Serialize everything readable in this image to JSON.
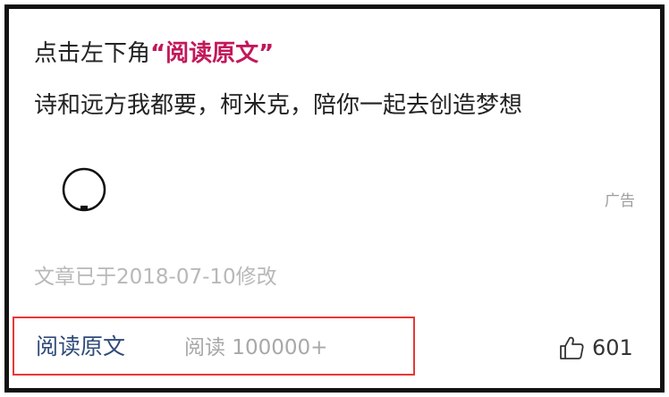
{
  "header": {
    "prompt_prefix": "点击左下角",
    "prompt_link": "“阅读原文”"
  },
  "body": {
    "slogan": "诗和远方我都要，柯米克，陪你一起去创造梦想"
  },
  "ad": {
    "label": "广告",
    "loader_icon": "loading-spinner-icon"
  },
  "meta": {
    "modified_text": "文章已于2018-07-10修改"
  },
  "footer": {
    "read_original_label": "阅读原文",
    "read_count_text": "阅读 100000+",
    "like_icon": "thumbs-up-icon",
    "like_count": "601",
    "highlight_color": "#e53935"
  }
}
